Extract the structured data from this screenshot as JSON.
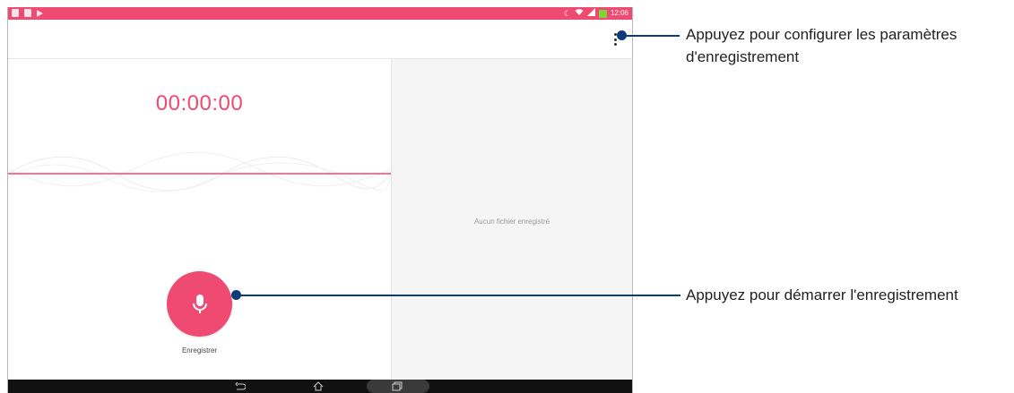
{
  "status_bar": {
    "time": "12:06",
    "left_icons": [
      "image-icon",
      "shield-icon",
      "play-icon"
    ],
    "right_icons": [
      "moon-icon",
      "wifi-icon",
      "signal-icon",
      "battery-charging-icon"
    ],
    "colors": {
      "background": "#ef4a72",
      "battery": "#7bd63a"
    }
  },
  "app_bar": {
    "menu_icon": "more-vert-icon"
  },
  "recorder": {
    "timer": "00:00:00",
    "record_label": "Enregistrer",
    "mic_icon": "microphone-icon",
    "accent_color": "#ef4a72"
  },
  "recordings": {
    "empty_message": "Aucun fichier enregistré"
  },
  "nav_bar": {
    "icons": [
      "back-icon",
      "home-icon",
      "recents-icon"
    ]
  },
  "callouts": {
    "settings": "Appuyez pour configurer les paramètres d'enregistrement",
    "settings_line1": "Appuyez pour configurer les paramètres",
    "settings_line2": "d'enregistrement",
    "record": "Appuyez pour démarrer l'enregistrement",
    "color": "#0b3d7c"
  }
}
